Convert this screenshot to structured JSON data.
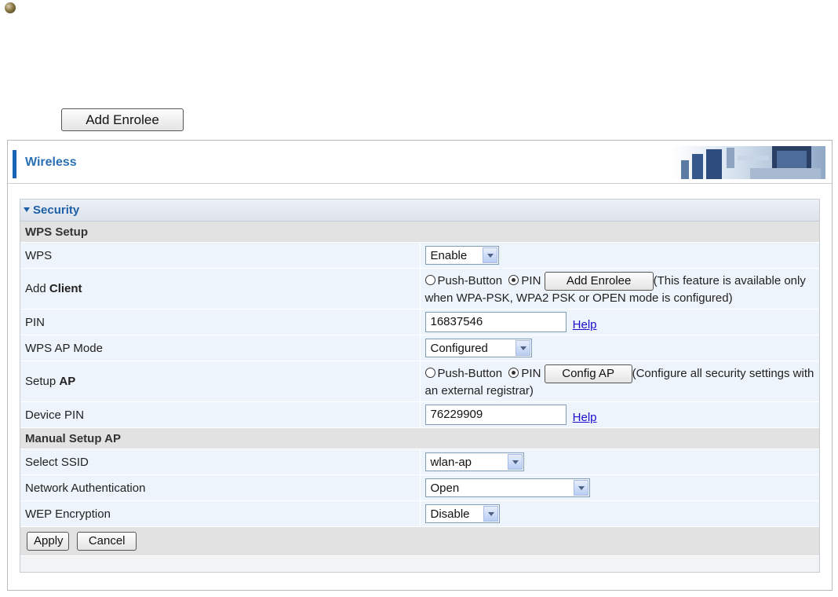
{
  "top": {
    "add_enrolee_label": "Add Enrolee"
  },
  "header": {
    "title": "Wireless"
  },
  "section": {
    "title": "Security"
  },
  "wps_setup": {
    "group_label": "WPS Setup",
    "wps": {
      "label": "WPS",
      "value": "Enable"
    },
    "add_client": {
      "label_prefix": "Add ",
      "label_bold": "Client",
      "option_push": "Push-Button",
      "option_pin": "PIN",
      "selected": "PIN",
      "button": "Add Enrolee",
      "note": "(This feature is available only when WPA-PSK, WPA2 PSK or OPEN mode is configured)"
    },
    "pin": {
      "label": "PIN",
      "value": "16837546",
      "help": "Help"
    },
    "ap_mode": {
      "label": "WPS AP Mode",
      "value": "Configured"
    },
    "setup_ap": {
      "label_prefix": "Setup ",
      "label_bold": "AP",
      "option_push": "Push-Button",
      "option_pin": "PIN",
      "selected": "PIN",
      "button": "Config AP",
      "note": "(Configure all security settings with an external registrar)"
    },
    "device_pin": {
      "label": "Device PIN",
      "value": "76229909",
      "help": "Help"
    }
  },
  "manual_setup": {
    "group_label": "Manual Setup AP",
    "ssid": {
      "label": "Select SSID",
      "value": "wlan-ap"
    },
    "auth": {
      "label": "Network Authentication",
      "value": "Open"
    },
    "wep": {
      "label": "WEP Encryption",
      "value": "Disable"
    }
  },
  "footer": {
    "apply": "Apply",
    "cancel": "Cancel"
  },
  "colors": {
    "accent": "#1763b5",
    "title": "#2b6fb4",
    "row_bg": "#eef4fb",
    "group_bg": "#e2e2e2"
  }
}
